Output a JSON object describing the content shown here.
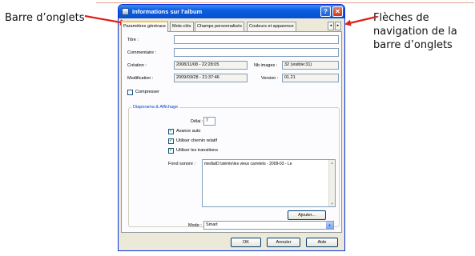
{
  "annotations": {
    "left": "Barre d’onglets",
    "right": "Flèches de navigation de la barre d’onglets"
  },
  "window": {
    "title": "Informations sur l'album",
    "help_button": "?",
    "close_button": "✕"
  },
  "tabs": [
    {
      "label": "Paramètres généraux",
      "active": true
    },
    {
      "label": "Mots-clés"
    },
    {
      "label": "Champs personnalisés"
    },
    {
      "label": "Couleurs et apparence"
    }
  ],
  "tab_scroll": {
    "left": "◂",
    "right": "▸"
  },
  "form": {
    "title_label": "Titre :",
    "title_value": "",
    "comment_label": "Commentaire :",
    "comment_value": "",
    "creation_label": "Création :",
    "creation_value": "2008/11/08 - 22:28:05",
    "nb_images_label": "Nb images :",
    "nb_images_value": "32 (visible:31)",
    "modification_label": "Modification :",
    "modification_value": "2009/03/28 - 21:37:46",
    "version_label": "Version :",
    "version_value": "01.21",
    "compress_label": "Compresser",
    "compress_checked": false
  },
  "slideshow": {
    "group_title": "Diaporama & Affichage",
    "delay_label": "Délai :",
    "delay_value": "7",
    "auto_advance_label": "Avance auto",
    "auto_advance_checked": true,
    "relative_path_label": "Utiliser chemin relatif",
    "relative_path_checked": true,
    "transitions_label": "Utiliser les transitions",
    "transitions_checked": true,
    "sound_label": "Fond sonore :",
    "sound_value": "mediaID:\\stéréo\\les vieux carrelets - 2009-03 - Le",
    "add_button": "Ajouter...",
    "mode_label": "Mode :",
    "mode_value": "Smart"
  },
  "footer": {
    "ok": "OK",
    "cancel": "Annuler",
    "help": "Aide"
  }
}
